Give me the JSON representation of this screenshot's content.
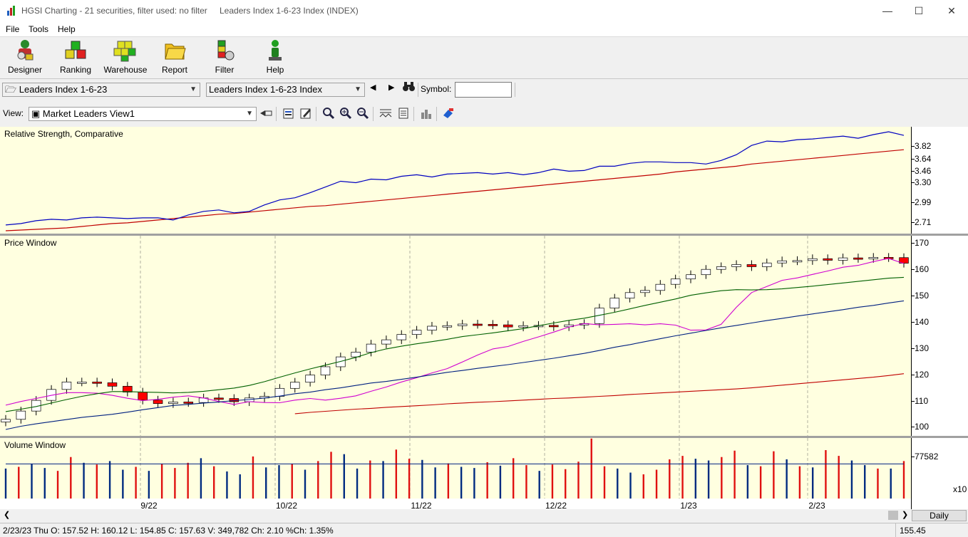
{
  "window": {
    "app_title": "HGSI Charting - 21 securities, filter used: no filter",
    "doc_title": "Leaders Index 1-6-23 Index (INDEX)"
  },
  "menu": [
    "File",
    "Tools",
    "Help"
  ],
  "toolbar": {
    "buttons": [
      {
        "label": "Designer",
        "icon": "designer-icon"
      },
      {
        "label": "Ranking",
        "icon": "ranking-icon"
      },
      {
        "label": "Warehouse",
        "icon": "warehouse-icon"
      },
      {
        "label": "Report",
        "icon": "report-icon"
      },
      {
        "label": "Filter",
        "icon": "filter-icon"
      },
      {
        "label": "Help",
        "icon": "help-icon"
      }
    ]
  },
  "selector": {
    "list_value": "Leaders Index 1-6-23",
    "security_value": "Leaders Index 1-6-23 Index",
    "symbol_label": "Symbol:",
    "symbol_value": ""
  },
  "view": {
    "label": "View:",
    "value": "Market Leaders View1"
  },
  "panes": {
    "rs_title": "Relative Strength, Comparative",
    "price_title": "Price Window",
    "volume_title": "Volume Window"
  },
  "rs_axis": [
    "3.82",
    "3.64",
    "3.46",
    "3.30",
    "2.99",
    "2.71"
  ],
  "price_axis": [
    "170",
    "160",
    "150",
    "140",
    "130",
    "120",
    "110",
    "100"
  ],
  "volume_axis": {
    "value": "77582",
    "multiplier": "x10"
  },
  "x_labels": [
    "9/22",
    "10/22",
    "11/22",
    "12/22",
    "1/23",
    "2/23"
  ],
  "period_button": "Daily",
  "status": {
    "text": "2/23/23 Thu O: 157.52 H: 160.12 L: 154.85 C: 157.63 V: 349,782 Ch: 2.10 %Ch: 1.35%",
    "right_value": "155.45"
  },
  "colors": {
    "pane_bg": "#ffffe0",
    "up_candle": "#ffffff",
    "down_candle": "#ff0000",
    "rs_line": "#0000c0",
    "rs_ma": "#c00000",
    "ma_short": "#d000d0",
    "ma_mid": "#006000",
    "ma_long": "#002080",
    "ma_longest": "#c00000"
  },
  "chart_data": [
    {
      "type": "line",
      "title": "Relative Strength, Comparative",
      "ylim": [
        2.64,
        4.05
      ],
      "series": [
        {
          "values": [
            2.64,
            2.65,
            2.66,
            2.67,
            2.68,
            2.7,
            2.72,
            2.74,
            2.75,
            2.77,
            2.79,
            2.81,
            2.83,
            2.85,
            2.87,
            2.88,
            2.9,
            2.92,
            2.94,
            2.96,
            2.98,
            2.99,
            3.01,
            3.03,
            3.05,
            3.07,
            3.09,
            3.11,
            3.13,
            3.15,
            3.17,
            3.19,
            3.21,
            3.23,
            3.25,
            3.27,
            3.29,
            3.31,
            3.33,
            3.35,
            3.37,
            3.39,
            3.41,
            3.43,
            3.46,
            3.48,
            3.5,
            3.52,
            3.54,
            3.57,
            3.59,
            3.61,
            3.63,
            3.65,
            3.67,
            3.69,
            3.71,
            3.73,
            3.75,
            3.77
          ]
        },
        {
          "values": [
            2.72,
            2.74,
            2.78,
            2.8,
            2.79,
            2.82,
            2.83,
            2.82,
            2.81,
            2.82,
            2.82,
            2.79,
            2.86,
            2.91,
            2.93,
            2.89,
            2.91,
            3.0,
            3.07,
            3.1,
            3.17,
            3.25,
            3.33,
            3.31,
            3.36,
            3.35,
            3.4,
            3.42,
            3.39,
            3.43,
            3.44,
            3.45,
            3.43,
            3.45,
            3.42,
            3.45,
            3.5,
            3.47,
            3.48,
            3.54,
            3.54,
            3.58,
            3.6,
            3.6,
            3.59,
            3.59,
            3.57,
            3.62,
            3.7,
            3.83,
            3.89,
            3.88,
            3.91,
            3.92,
            3.94,
            3.96,
            3.93,
            3.98,
            4.02,
            3.97
          ]
        }
      ]
    },
    {
      "type": "line",
      "title": "Price Window",
      "ylim": [
        96,
        171
      ],
      "series": [
        {
          "values": [
            107.5,
            108.9,
            110.0,
            111.2,
            112.2,
            112.2,
            112.0,
            111.2,
            110.1,
            109.2,
            109.7,
            110.5,
            111.0,
            110.2,
            108.9,
            107.8,
            108.8,
            108.5,
            108.4,
            109.4,
            110.0,
            109.4,
            110.1,
            111.0,
            112.7,
            114.3,
            116.2,
            117.8,
            119.6,
            121.2,
            123.7,
            126.3,
            128.6,
            129.5,
            131.4,
            133.1,
            134.9,
            136.8,
            138.1,
            137.6,
            137.8,
            138.0,
            137.6,
            138.0,
            137.5,
            135.6,
            135.7,
            137.8,
            144.2,
            149.7,
            152.0,
            154.3,
            155.2,
            156.5,
            157.8,
            159.2,
            159.9,
            161.3,
            162.5,
            160.6
          ]
        },
        {
          "values": [
            102.2,
            105.3,
            109.3,
            113.4,
            116.2,
            116.2,
            115.9,
            114.6,
            112.4,
            109.4,
            108.1,
            108.7,
            108.5,
            110.2,
            110.0,
            108.8,
            110.2,
            110.8,
            113.8,
            116.1,
            118.8,
            121.9,
            125.6,
            127.4,
            130.4,
            132.0,
            134.0,
            135.6,
            137.1,
            137.3,
            137.9,
            137.8,
            137.6,
            136.8,
            137.3,
            137.4,
            136.9,
            137.6,
            138.1,
            143.9,
            147.6,
            149.7,
            150.5,
            152.8,
            154.8,
            156.4,
            158.4,
            159.4,
            160.2,
            159.4,
            160.8,
            161.6,
            161.7,
            162.4,
            161.8,
            162.7,
            162.5,
            162.9,
            162.8,
            160.7
          ]
        },
        {
          "values": [
            105.1,
            106.0,
            107.0,
            108.3,
            109.6,
            110.8,
            111.8,
            112.6,
            112.6,
            112.4,
            112.3,
            112.1,
            112.3,
            112.7,
            113.3,
            113.9,
            114.9,
            116.3,
            118.0,
            119.6,
            121.1,
            122.5,
            123.9,
            125.4,
            127.2,
            128.6,
            129.6,
            130.5,
            131.3,
            132.2,
            133.2,
            133.9,
            134.6,
            135.4,
            136.2,
            137.3,
            138.3,
            139.3,
            140.1,
            141.2,
            142.3,
            143.6,
            144.9,
            146.1,
            147.3,
            148.7,
            149.6,
            150.4,
            150.8,
            150.7,
            150.8,
            151.1,
            151.6,
            152.1,
            152.7,
            153.3,
            153.9,
            154.5,
            155.1,
            155.4
          ]
        },
        {
          "values": [
            98.4,
            99.6,
            100.5,
            101.3,
            102.1,
            102.9,
            103.5,
            104.1,
            104.9,
            105.8,
            106.6,
            107.4,
            107.8,
            108.3,
            108.7,
            109.2,
            109.6,
            110.2,
            110.9,
            111.8,
            112.4,
            113.3,
            114.0,
            114.9,
            115.8,
            116.4,
            117.2,
            118.0,
            118.9,
            119.8,
            120.5,
            121.3,
            122.0,
            122.7,
            123.5,
            124.3,
            125.1,
            126.0,
            126.9,
            128.0,
            129.2,
            130.2,
            131.3,
            132.4,
            133.5,
            134.5,
            135.5,
            136.5,
            137.4,
            138.3,
            139.2,
            140.0,
            140.9,
            141.7,
            142.5,
            143.3,
            144.2,
            144.9,
            145.8,
            146.6
          ]
        },
        {
          "values": [
            null,
            null,
            null,
            null,
            null,
            null,
            null,
            null,
            null,
            null,
            null,
            null,
            null,
            null,
            null,
            null,
            null,
            null,
            null,
            104.3,
            104.8,
            105.2,
            105.6,
            106.0,
            106.3,
            106.7,
            107.0,
            107.3,
            107.6,
            108.0,
            108.3,
            108.6,
            108.8,
            109.1,
            109.4,
            109.7,
            110.0,
            110.2,
            110.5,
            110.8,
            111.1,
            111.5,
            111.8,
            112.1,
            112.4,
            112.7,
            113.0,
            113.3,
            113.6,
            114.0,
            114.5,
            115.0,
            115.5,
            116.0,
            116.5,
            117.0,
            117.5,
            118.0,
            118.6,
            119.3
          ]
        }
      ]
    },
    {
      "type": "bar",
      "title": "Volume Window",
      "ylim": [
        0,
        105000
      ],
      "values": [
        52000,
        55000,
        60000,
        53000,
        48000,
        72000,
        62000,
        59000,
        65000,
        50000,
        55000,
        48000,
        60000,
        53000,
        62000,
        70000,
        56000,
        47000,
        42000,
        73000,
        54000,
        58000,
        60000,
        50000,
        65000,
        81000,
        77000,
        52000,
        66000,
        65000,
        85000,
        69000,
        67000,
        54000,
        61000,
        55000,
        53000,
        63000,
        57000,
        70000,
        58000,
        48000,
        59000,
        51000,
        64000,
        104000,
        56000,
        52000,
        45000,
        42000,
        50000,
        68000,
        74000,
        69000,
        66000,
        72000,
        83000,
        58000,
        56000,
        82000,
        68000,
        56000,
        54000,
        84000,
        74000,
        66000,
        58000,
        52000,
        52000,
        65000
      ],
      "ma": 60000
    }
  ]
}
